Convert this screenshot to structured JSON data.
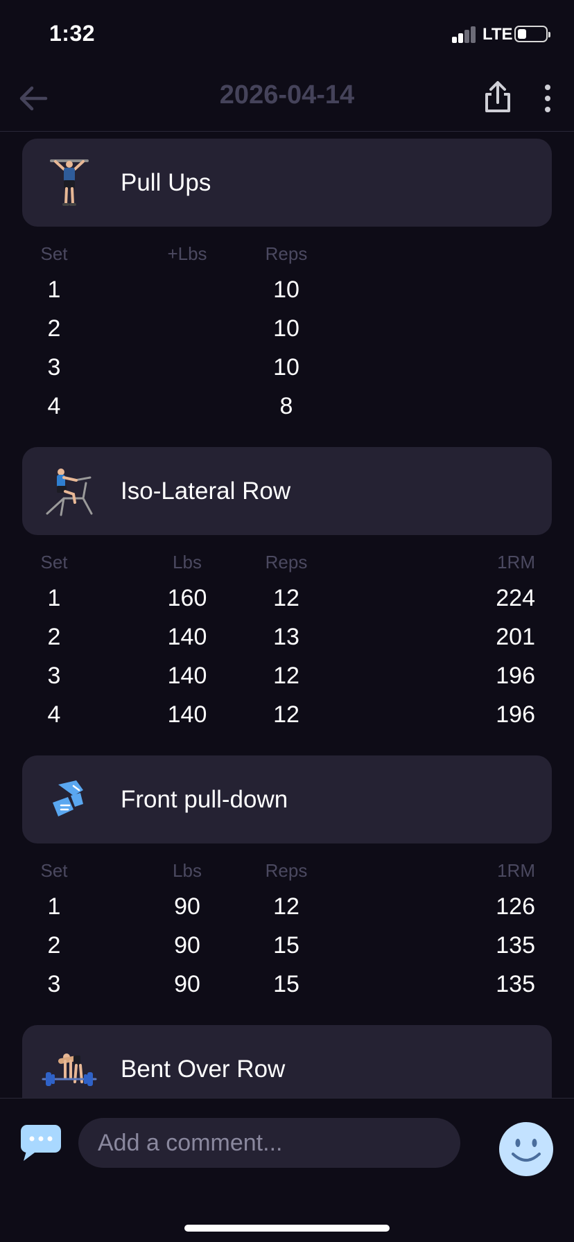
{
  "status_bar": {
    "time": "1:32",
    "network": "LTE"
  },
  "header": {
    "title": "2026-04-14"
  },
  "columns": {
    "set": "Set",
    "lbs": "Lbs",
    "plus_lbs": "+Lbs",
    "reps": "Reps",
    "one_rm": "1RM"
  },
  "exercises": [
    {
      "name": "Pull Ups",
      "icon": "pull-ups-figure",
      "sets": [
        {
          "set": "1",
          "lbs": "",
          "reps": "10",
          "one_rm": ""
        },
        {
          "set": "2",
          "lbs": "",
          "reps": "10",
          "one_rm": ""
        },
        {
          "set": "3",
          "lbs": "",
          "reps": "10",
          "one_rm": ""
        },
        {
          "set": "4",
          "lbs": "",
          "reps": "8",
          "one_rm": ""
        }
      ]
    },
    {
      "name": "Iso-Lateral Row",
      "icon": "row-machine-figure",
      "sets": [
        {
          "set": "1",
          "lbs": "160",
          "reps": "12",
          "one_rm": "224"
        },
        {
          "set": "2",
          "lbs": "140",
          "reps": "13",
          "one_rm": "201"
        },
        {
          "set": "3",
          "lbs": "140",
          "reps": "12",
          "one_rm": "196"
        },
        {
          "set": "4",
          "lbs": "140",
          "reps": "12",
          "one_rm": "196"
        }
      ]
    },
    {
      "name": "Front pull-down",
      "icon": "generic-exercise",
      "sets": [
        {
          "set": "1",
          "lbs": "90",
          "reps": "12",
          "one_rm": "126"
        },
        {
          "set": "2",
          "lbs": "90",
          "reps": "15",
          "one_rm": "135"
        },
        {
          "set": "3",
          "lbs": "90",
          "reps": "15",
          "one_rm": "135"
        }
      ]
    },
    {
      "name": "Bent Over Row",
      "icon": "barbell-row-figure",
      "sets": []
    }
  ],
  "comment": {
    "placeholder": "Add a comment..."
  },
  "colors": {
    "background": "#0e0c17",
    "card": "#252233",
    "title_muted": "#45435a",
    "header_muted": "#4b4960",
    "accent_blue": "#5aa7f0"
  }
}
